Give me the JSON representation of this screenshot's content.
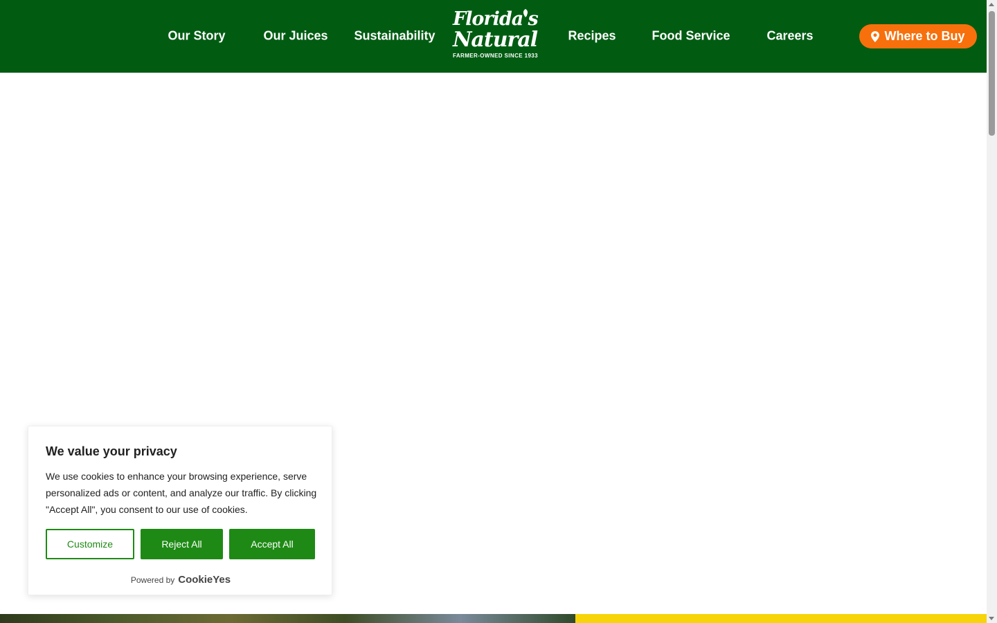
{
  "header": {
    "nav_left": [
      "Our Story",
      "Our Juices",
      "Sustainability"
    ],
    "nav_right": [
      "Recipes",
      "Food Service",
      "Careers"
    ],
    "logo": {
      "line1": "Florida's",
      "line2": "Natural",
      "tagline": "FARMER-OWNED SINCE 1933"
    },
    "where_to_buy": "Where to Buy",
    "background_color": "#015c12",
    "button_color": "#f7700c"
  },
  "cookie_banner": {
    "title": "We value your privacy",
    "text": "We use cookies to enhance your browsing experience, serve personalized ads or content, and analyze our traffic. By clicking \"Accept All\", you consent to our use of cookies.",
    "customize_label": "Customize",
    "reject_label": "Reject All",
    "accept_label": "Accept All",
    "powered_by": "Powered by",
    "powered_brand": "CookieYes",
    "accent_color": "#1e8a15"
  }
}
